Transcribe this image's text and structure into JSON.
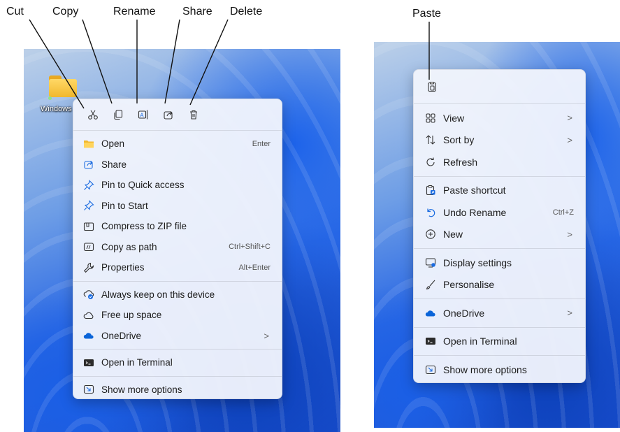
{
  "callouts": {
    "cut": "Cut",
    "copy": "Copy",
    "rename": "Rename",
    "share": "Share",
    "delete": "Delete",
    "paste": "Paste"
  },
  "desktop_left": {
    "folder_label": "Windows"
  },
  "file_menu": {
    "items": [
      {
        "label": "Open",
        "shortcut": "Enter",
        "icon": "folder-icon"
      },
      {
        "label": "Share",
        "icon": "share-icon"
      },
      {
        "label": "Pin to Quick access",
        "icon": "pin-icon"
      },
      {
        "label": "Pin to Start",
        "icon": "pin-icon"
      },
      {
        "label": "Compress to ZIP file",
        "icon": "zip-icon"
      },
      {
        "label": "Copy as path",
        "shortcut": "Ctrl+Shift+C",
        "icon": "copy-path-icon"
      },
      {
        "label": "Properties",
        "shortcut": "Alt+Enter",
        "icon": "wrench-icon"
      },
      {
        "label": "Always keep on this device",
        "icon": "cloud-sync-icon"
      },
      {
        "label": "Free up space",
        "icon": "cloud-icon"
      },
      {
        "label": "OneDrive",
        "chevron": ">",
        "icon": "onedrive-icon"
      },
      {
        "label": "Open in Terminal",
        "icon": "terminal-icon"
      },
      {
        "label": "Show more options",
        "icon": "more-options-icon"
      }
    ]
  },
  "desktop_menu": {
    "items": [
      {
        "label": "View",
        "chevron": ">",
        "icon": "grid-icon"
      },
      {
        "label": "Sort by",
        "chevron": ">",
        "icon": "sort-icon"
      },
      {
        "label": "Refresh",
        "icon": "refresh-icon"
      },
      {
        "label": "Paste shortcut",
        "icon": "paste-shortcut-icon"
      },
      {
        "label": "Undo Rename",
        "shortcut": "Ctrl+Z",
        "icon": "undo-icon"
      },
      {
        "label": "New",
        "chevron": ">",
        "icon": "plus-circle-icon"
      },
      {
        "label": "Display settings",
        "icon": "display-icon"
      },
      {
        "label": "Personalise",
        "icon": "brush-icon"
      },
      {
        "label": "OneDrive",
        "chevron": ">",
        "icon": "onedrive-icon"
      },
      {
        "label": "Open in Terminal",
        "icon": "terminal-icon"
      },
      {
        "label": "Show more options",
        "icon": "more-options-icon"
      }
    ]
  },
  "colors": {
    "accent": "#1a6be0",
    "folder": "#f1b82e",
    "onedrive": "#0a64d8"
  }
}
